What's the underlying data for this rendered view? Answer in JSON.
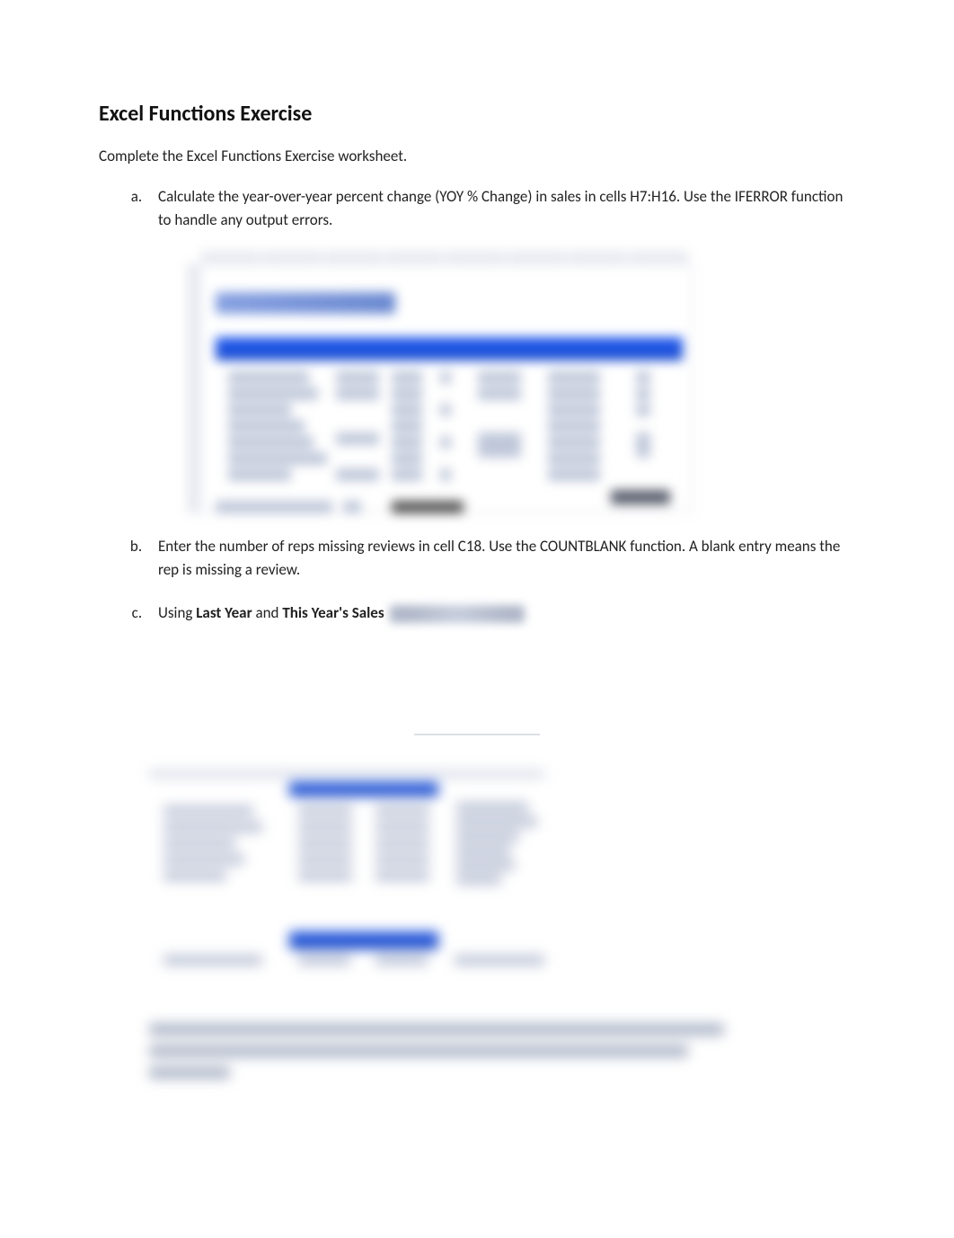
{
  "title": "Excel Functions Exercise",
  "intro": "Complete the Excel Functions Exercise worksheet.",
  "items": {
    "a": "Calculate the year-over-year percent change (YOY % Change) in sales in cells H7:H16. Use the IFERROR function to handle any output errors.",
    "b": "Enter the number of reps missing reviews in cell C18. Use the COUNTBLANK function. A blank entry means the rep is missing a review.",
    "c_prefix": "Using ",
    "c_bold1": "Last Year",
    "c_mid": " and ",
    "c_bold2": "This Year's Sales"
  }
}
